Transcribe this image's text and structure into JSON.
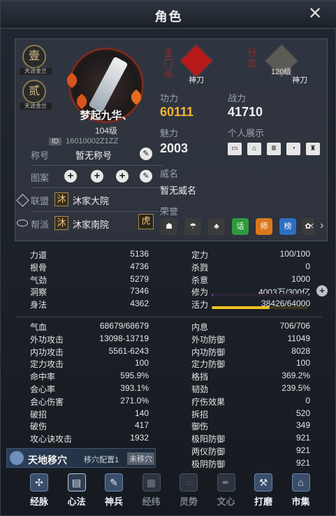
{
  "window": {
    "title": "角色",
    "close_icon": "close-icon"
  },
  "profile": {
    "badge_1": "壹",
    "badge_1_caption": "天涯金兰",
    "badge_2": "贰",
    "badge_2_caption": "天涯金兰",
    "name": "梦起九华、",
    "level": "104级",
    "id_tag": "ID",
    "id_value": "16010002Z1ZZ",
    "title_label": "称号",
    "title_value": "暂无称号",
    "pattern_label": "图案",
    "alliance_label": "联盟",
    "alliance_icon": "沐",
    "alliance_value": "沐家大院",
    "faction_label": "帮派",
    "faction_icon": "沐",
    "faction_value": "沐家南院",
    "main_school_tab": "主门派",
    "main_school_name": "神刀",
    "walk_tab": "行武",
    "walk_level": "120级",
    "walk_name": "神刀",
    "gongli_label": "功力",
    "gongli_value": "60111",
    "zhanli_label": "战力",
    "zhanli_value": "41710",
    "meili_label": "魅力",
    "meili_value": "2003",
    "show_label": "个人展示",
    "weiming_label": "威名",
    "weiming_value": "暂无威名",
    "honor_label": "荣誉",
    "honor_items": [
      "话",
      "师",
      "榜"
    ]
  },
  "stats_left_top": [
    {
      "k": "力道",
      "v": "5136"
    },
    {
      "k": "根骨",
      "v": "4736"
    },
    {
      "k": "气劲",
      "v": "5279"
    },
    {
      "k": "洞察",
      "v": "7346"
    },
    {
      "k": "身法",
      "v": "4362"
    }
  ],
  "stats_right_top": [
    {
      "k": "定力",
      "v": "100/100"
    },
    {
      "k": "杀戮",
      "v": "0"
    },
    {
      "k": "杀意",
      "v": "1000"
    },
    {
      "k": "修为",
      "v": "4003万/300亿"
    },
    {
      "k": "活力",
      "v": "38426/64000"
    }
  ],
  "bars": {
    "xiuwei_fraction": 0.0013,
    "huoli_fraction": 0.6
  },
  "stats_left": [
    {
      "k": "气血",
      "v": "68679/68679"
    },
    {
      "k": "外功攻击",
      "v": "13098-13719"
    },
    {
      "k": "内功攻击",
      "v": "5561-6243"
    },
    {
      "k": "定力攻击",
      "v": "100"
    },
    {
      "k": "命中率",
      "v": "595.9%"
    },
    {
      "k": "会心率",
      "v": "393.1%"
    },
    {
      "k": "会心伤害",
      "v": "271.0%"
    },
    {
      "k": "破招",
      "v": "140"
    },
    {
      "k": "破伤",
      "v": "417"
    },
    {
      "k": "攻心诀攻击",
      "v": "1932"
    }
  ],
  "stats_right": [
    {
      "k": "内息",
      "v": "706/706"
    },
    {
      "k": "外功防御",
      "v": "11049"
    },
    {
      "k": "内功防御",
      "v": "8028"
    },
    {
      "k": "定力防御",
      "v": "100"
    },
    {
      "k": "格挡",
      "v": "369.2%"
    },
    {
      "k": "韧劲",
      "v": "239.5%"
    },
    {
      "k": "疗伤效果",
      "v": "0"
    },
    {
      "k": "拆招",
      "v": "520"
    },
    {
      "k": "御伤",
      "v": "349"
    },
    {
      "k": "极阳防御",
      "v": "921"
    },
    {
      "k": "两仪防御",
      "v": "921"
    },
    {
      "k": "极阴防御",
      "v": "921"
    }
  ],
  "acupoint": {
    "name": "天地移穴",
    "config": "移穴配置1",
    "tag": "未移穴"
  },
  "nav": [
    {
      "label": "经脉",
      "icon": "meridian-icon",
      "glyph": "✣",
      "state": "normal"
    },
    {
      "label": "心法",
      "icon": "book-icon",
      "glyph": "▤",
      "state": "on"
    },
    {
      "label": "神兵",
      "icon": "weapon-icon",
      "glyph": "✎",
      "state": "normal"
    },
    {
      "label": "经纬",
      "icon": "grid-icon",
      "glyph": "▦",
      "state": "dim"
    },
    {
      "label": "灵势",
      "icon": "spirit-icon",
      "glyph": "◌",
      "state": "dim"
    },
    {
      "label": "文心",
      "icon": "brush-icon",
      "glyph": "✒",
      "state": "dim"
    },
    {
      "label": "打磨",
      "icon": "hammer-icon",
      "glyph": "⚒",
      "state": "normal"
    },
    {
      "label": "市集",
      "icon": "market-icon",
      "glyph": "⌂",
      "state": "normal"
    }
  ],
  "colors": {
    "gongli": "#f5b52e",
    "huoli_bar": "#f0c020",
    "xiuwei_bar": "#5a46b8",
    "accent_red": "#c4201a"
  }
}
